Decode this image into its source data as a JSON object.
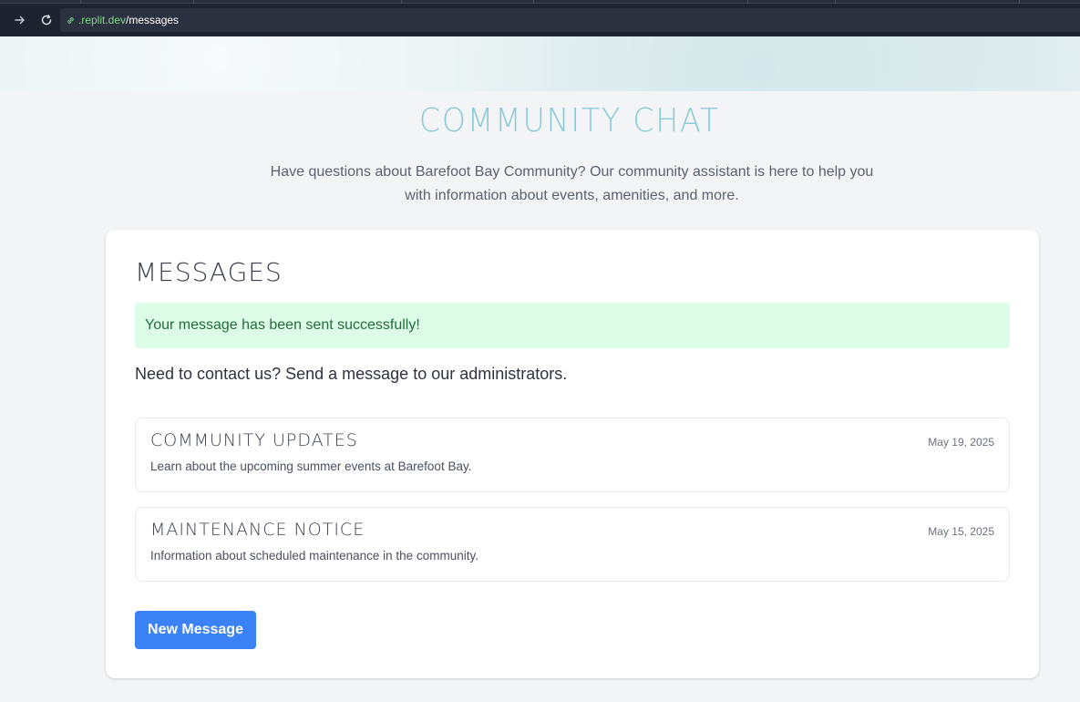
{
  "browser": {
    "url_domain": ".replit.dev",
    "url_path": "/messages",
    "icons": [
      "forward-icon",
      "reload-icon",
      "link-icon"
    ]
  },
  "page": {
    "title": "COMMUNITY CHAT",
    "intro": "Have questions about Barefoot Bay Community? Our community assistant is here to help you with information about events, amenities, and more."
  },
  "messages_card": {
    "heading": "MESSAGES",
    "success_alert": "Your message has been sent successfully!",
    "contact_prompt": "Need to contact us? Send a message to our administrators.",
    "items": [
      {
        "title": "COMMUNITY UPDATES",
        "date": "May 19, 2025",
        "body": "Learn about the upcoming summer events at Barefoot Bay."
      },
      {
        "title": "MAINTENANCE NOTICE",
        "date": "May 15, 2025",
        "body": "Information about scheduled maintenance in the community."
      }
    ],
    "new_button_label": "New Message"
  },
  "colors": {
    "accent": "#3b82f6",
    "title_teal": "#8ecad6",
    "alert_bg": "#dcfce7",
    "alert_text": "#256b3a"
  }
}
